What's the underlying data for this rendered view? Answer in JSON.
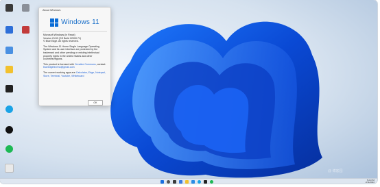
{
  "dialog": {
    "title": "About Windows",
    "brand": "Windows 11",
    "line1": "Microsoft Windows (in React)",
    "line2": "Version 21H2 (OS Build 22000.71)",
    "line3": "© Blue Edge. All rights reserved.",
    "para": "The Windows 11 Home Single Language Operating System and its user interface are protected by the trademark and other pending or existing intellectual property rights in the United States and other countries/regions.",
    "license_prefix": "This product is licensed with",
    "license_link": "Creative Commons",
    "contact_prefix": "contact:",
    "contact_link": "blueedgetechno@gmail.com",
    "apps_prefix": "The current working apps are",
    "apps_link": "Calculator, Edge, Notepad, Store, Terminal, Youtube, Whiteboard",
    "ok_label": "OK"
  },
  "taskbar": {
    "time": "5:24 PM",
    "date": "2/11/2022"
  },
  "watermark": "@ 博客园"
}
